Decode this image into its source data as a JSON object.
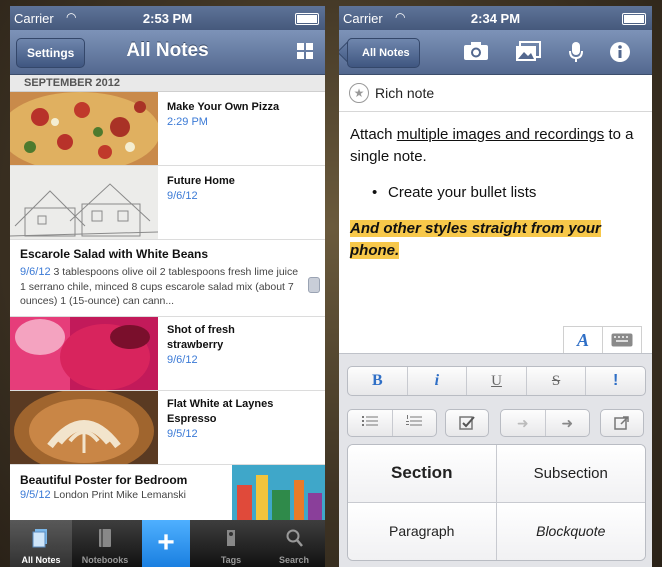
{
  "left": {
    "status": {
      "carrier": "Carrier",
      "time": "2:53 PM"
    },
    "nav": {
      "settings_label": "Settings",
      "title": "All Notes"
    },
    "section": "SEPTEMBER 2012",
    "notes": [
      {
        "title": "Make Your Own Pizza",
        "date": "2:29 PM"
      },
      {
        "title": "Future Home",
        "date": "9/6/12"
      },
      {
        "title": "Escarole Salad with White Beans",
        "date": "9/6/12",
        "body": "3 tablespoons olive oil 2 tablespoons fresh lime juice 1 serrano chile, minced 8 cups escarole salad mix (about 7 ounces) 1 (15-ounce) can cann..."
      },
      {
        "title": "Shot of fresh strawberry",
        "date": "9/6/12"
      },
      {
        "title": "Flat White at Laynes Espresso",
        "date": "9/5/12"
      },
      {
        "title": "Beautiful  Poster for Bedroom",
        "date": "9/5/12",
        "body": "London Print Mike Lemanski"
      }
    ],
    "tabs": [
      "All Notes",
      "Notebooks",
      "",
      "Tags",
      "Search"
    ]
  },
  "right": {
    "status": {
      "carrier": "Carrier",
      "time": "2:34 PM"
    },
    "nav": {
      "back_label": "All Notes"
    },
    "note_title": "Rich note",
    "content": {
      "line1_pre": "Attach ",
      "line1_link": "multiple images and recordings",
      "line1_post": " to a single note.",
      "bullet": "Create your bullet lists",
      "highlight": "And other styles straight from your phone."
    },
    "format": {
      "bold": "B",
      "italic": "i",
      "underline": "U",
      "strike": "S",
      "important": "!",
      "font_tab": "A"
    },
    "styles": [
      "Section",
      "Subsection",
      "Paragraph",
      "Blockquote"
    ]
  },
  "colors": {
    "nav_blue": "#53688f",
    "link_blue": "#3b7ad6",
    "highlight": "#f7c84a",
    "add_blue": "#1a7fe0"
  }
}
